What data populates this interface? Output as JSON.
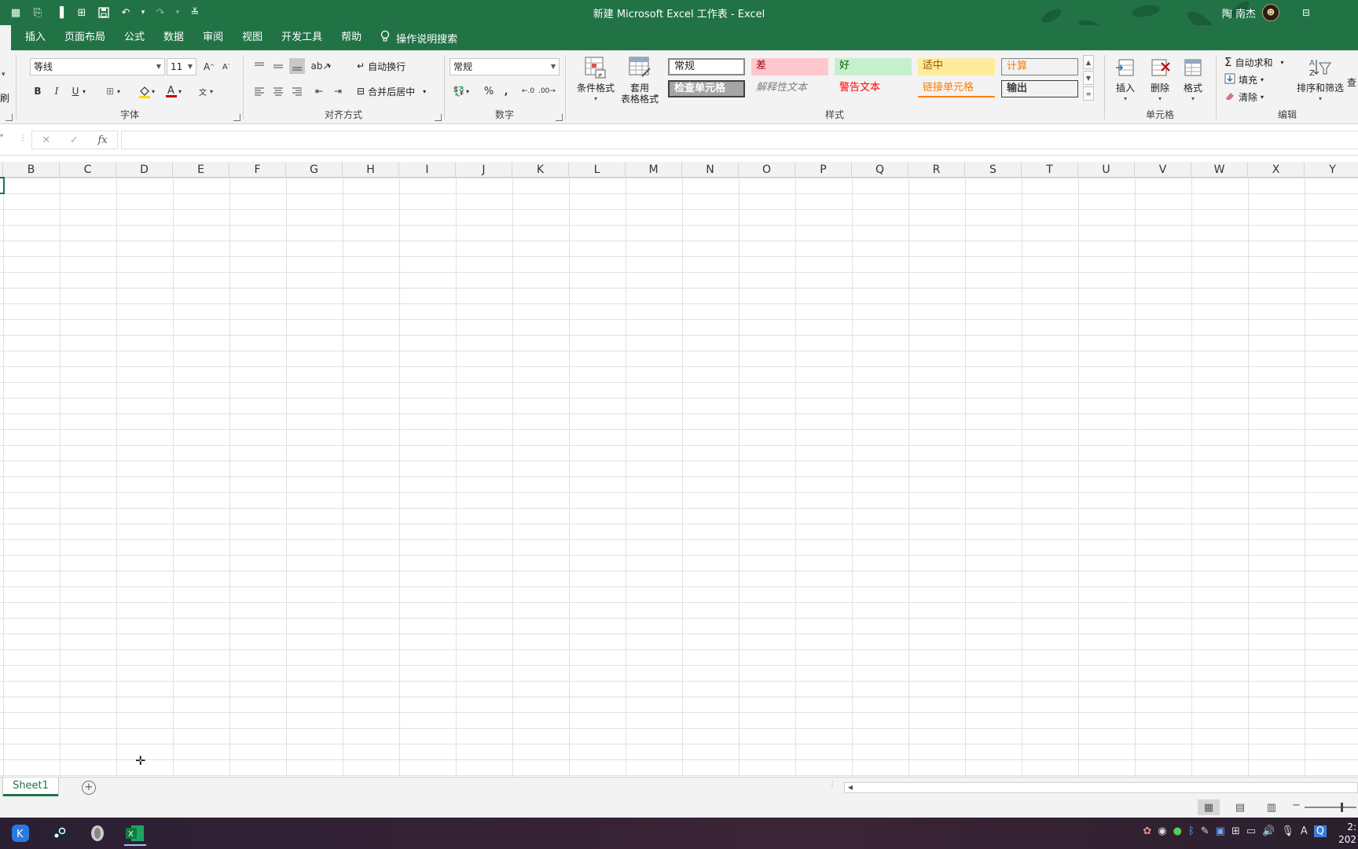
{
  "window": {
    "title": "新建 Microsoft Excel 工作表  -  Excel",
    "user_name": "陶 南杰"
  },
  "tabs": [
    "插入",
    "页面布局",
    "公式",
    "数据",
    "审阅",
    "视图",
    "开发工具",
    "帮助"
  ],
  "tell_me": "操作说明搜索",
  "ribbon": {
    "clipboard_partial": "刷",
    "font": {
      "name": "等线",
      "size": "11",
      "label": "字体"
    },
    "alignment": {
      "wrap_text": "自动换行",
      "merge_center": "合并后居中",
      "label": "对齐方式"
    },
    "number": {
      "format": "常规",
      "label": "数字"
    },
    "styles": {
      "conditional": "条件格式",
      "table_line1": "套用",
      "table_line2": "表格格式",
      "label": "样式",
      "gallery": [
        [
          "常规",
          "差",
          "好",
          "适中",
          "计算"
        ],
        [
          "检查单元格",
          "解释性文本",
          "警告文本",
          "链接单元格",
          "输出"
        ]
      ]
    },
    "cells": {
      "insert": "插入",
      "delete": "删除",
      "format": "格式",
      "label": "单元格"
    },
    "editing": {
      "autosum": "自动求和",
      "fill": "填充",
      "clear": "清除",
      "sort_filter": "排序和筛选",
      "find_partial": "查",
      "label": "编辑"
    }
  },
  "columns": [
    "B",
    "C",
    "D",
    "E",
    "F",
    "G",
    "H",
    "I",
    "J",
    "K",
    "L",
    "M",
    "N",
    "O",
    "P",
    "Q",
    "R",
    "S",
    "T",
    "U",
    "V",
    "W",
    "X",
    "Y"
  ],
  "sheet_tab": "Sheet1",
  "taskbar_clock": {
    "time_partial": "2:",
    "date_partial": "202"
  },
  "colors": {
    "excel_green": "#217346",
    "style_bad_bg": "#ffc7ce",
    "style_good_bg": "#c6efce",
    "style_neutral_bg": "#ffeb9c",
    "style_calc_bg": "#f2f2f2"
  }
}
